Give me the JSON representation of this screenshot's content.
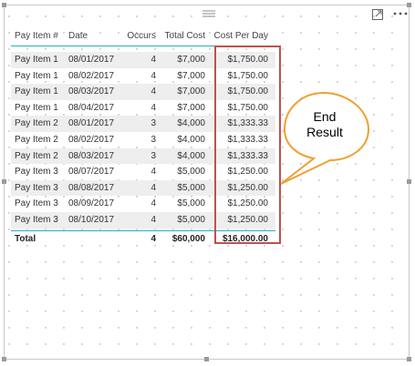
{
  "header": {
    "drag_icon": "grip-lines-icon",
    "focus_icon": "focus-mode-icon",
    "more_icon": "ellipsis-icon"
  },
  "table": {
    "columns": [
      "Pay Item #",
      "Date",
      "Occurs",
      "Total Cost",
      "Cost Per Day"
    ],
    "rows": [
      [
        "Pay Item 1",
        "08/01/2017",
        "4",
        "$7,000",
        "$1,750.00"
      ],
      [
        "Pay Item 1",
        "08/02/2017",
        "4",
        "$7,000",
        "$1,750.00"
      ],
      [
        "Pay Item 1",
        "08/03/2017",
        "4",
        "$7,000",
        "$1,750.00"
      ],
      [
        "Pay Item 1",
        "08/04/2017",
        "4",
        "$7,000",
        "$1,750.00"
      ],
      [
        "Pay Item 2",
        "08/01/2017",
        "3",
        "$4,000",
        "$1,333.33"
      ],
      [
        "Pay Item 2",
        "08/02/2017",
        "3",
        "$4,000",
        "$1,333.33"
      ],
      [
        "Pay Item 2",
        "08/03/2017",
        "3",
        "$4,000",
        "$1,333.33"
      ],
      [
        "Pay Item 3",
        "08/07/2017",
        "4",
        "$5,000",
        "$1,250.00"
      ],
      [
        "Pay Item 3",
        "08/08/2017",
        "4",
        "$5,000",
        "$1,250.00"
      ],
      [
        "Pay Item 3",
        "08/09/2017",
        "4",
        "$5,000",
        "$1,250.00"
      ],
      [
        "Pay Item 3",
        "08/10/2017",
        "4",
        "$5,000",
        "$1,250.00"
      ]
    ],
    "total": {
      "label": "Total",
      "occurs": "4",
      "total_cost": "$60,000",
      "cost_per_day": "$16,000.00"
    }
  },
  "annotation": {
    "callout_line1": "End",
    "callout_line2": "Result",
    "highlight_color": "#c0504d",
    "callout_border_color": "#f0a030"
  },
  "colors": {
    "accent_rule": "#20b3c0",
    "alt_row": "#eeeeee"
  }
}
